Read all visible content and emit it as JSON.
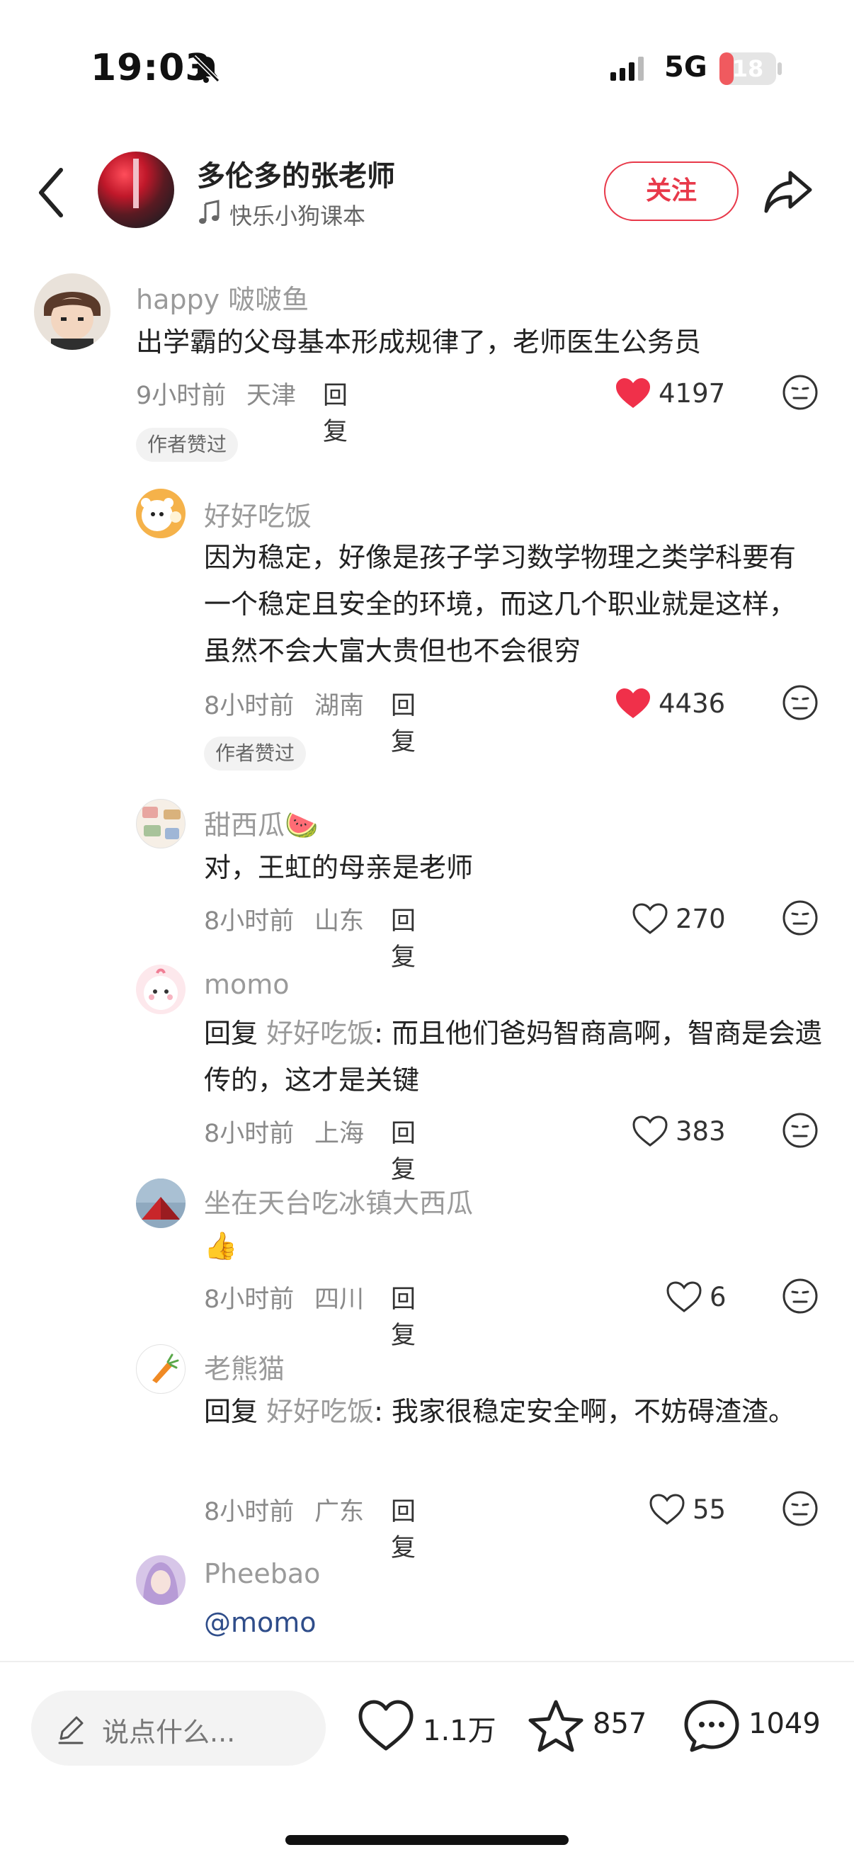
{
  "status_bar": {
    "time": "19:03",
    "network": "5G",
    "battery": "18",
    "battery_level": 0.18
  },
  "header": {
    "author_name": "多伦多的张老师",
    "music": "快乐小狗课本",
    "follow_label": "关注"
  },
  "comments": [
    {
      "user": "happy 啵啵鱼",
      "text": "出学霸的父母基本形成规律了，老师医生公务员",
      "time": "9小时前",
      "location": "天津",
      "reply_label": "回复",
      "likes": "4197",
      "liked": true,
      "tag": "作者赞过"
    },
    {
      "user": "好好吃饭",
      "text": "因为稳定，好像是孩子学习数学物理之类学科要有一个稳定且安全的环境，而这几个职业就是这样，虽然不会大富大贵但也不会很穷",
      "time": "8小时前",
      "location": "湖南",
      "reply_label": "回复",
      "likes": "4436",
      "liked": true,
      "tag": "作者赞过"
    },
    {
      "user": "甜西瓜🍉",
      "text": "对，王虹的母亲是老师",
      "time": "8小时前",
      "location": "山东",
      "reply_label": "回复",
      "likes": "270",
      "liked": false
    },
    {
      "user": "momo",
      "reply_prefix": "回复 ",
      "reply_to": "好好吃饭",
      "text": ": 而且他们爸妈智商高啊，智商是会遗传的，这才是关键",
      "time": "8小时前",
      "location": "上海",
      "reply_label": "回复",
      "likes": "383",
      "liked": false
    },
    {
      "user": "坐在天台吃冰镇大西瓜",
      "text": "👍",
      "time": "8小时前",
      "location": "四川",
      "reply_label": "回复",
      "likes": "6",
      "liked": false
    },
    {
      "user": "老熊猫",
      "reply_prefix": "回复 ",
      "reply_to": "好好吃饭",
      "text": ": 我家很稳定安全啊，不妨碍渣渣。",
      "time": "8小时前",
      "location": "广东",
      "reply_label": "回复",
      "likes": "55",
      "liked": false
    },
    {
      "user": "Pheebao",
      "mention": "@momo"
    }
  ],
  "bottom_bar": {
    "placeholder": "说点什么...",
    "likes": "1.1万",
    "favorites": "857",
    "comments": "1049"
  },
  "colors": {
    "accent": "#e8394a",
    "like_red": "#f0304a",
    "mention_blue": "#2f4d8a"
  },
  "icons": [
    "bell-slash-icon",
    "signal-icon",
    "back-icon",
    "music-note-icon",
    "share-icon",
    "heart-icon",
    "dislike-face-icon",
    "pencil-icon",
    "star-icon",
    "comment-bubble-icon"
  ]
}
